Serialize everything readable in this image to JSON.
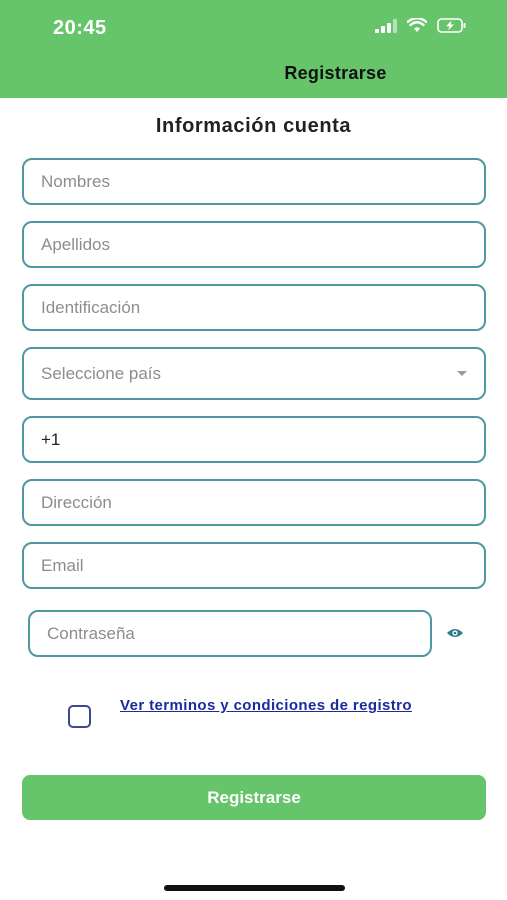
{
  "status_bar": {
    "time": "20:45",
    "icons": [
      "signal-icon",
      "wifi-icon",
      "battery-charging-icon"
    ]
  },
  "header": {
    "title": "Registrarse",
    "background": "#66c46a"
  },
  "form": {
    "section_title": "Información cuenta",
    "fields": {
      "nombres": {
        "placeholder": "Nombres",
        "value": ""
      },
      "apellidos": {
        "placeholder": "Apellidos",
        "value": ""
      },
      "identificacion": {
        "placeholder": "Identificación",
        "value": ""
      },
      "pais": {
        "placeholder": "Seleccione país"
      },
      "telefono": {
        "placeholder": "",
        "value": "+1"
      },
      "direccion": {
        "placeholder": "Dirección",
        "value": ""
      },
      "email": {
        "placeholder": "Email",
        "value": ""
      },
      "contrasena": {
        "placeholder": "Contraseña",
        "value": ""
      }
    },
    "terms": {
      "checked": false,
      "link_text": "Ver terminos y condiciones de registro"
    },
    "submit_label": "Registrarse"
  },
  "colors": {
    "accent": "#66c46a",
    "field_border": "#4e97a3",
    "link": "#1d2a9c"
  }
}
